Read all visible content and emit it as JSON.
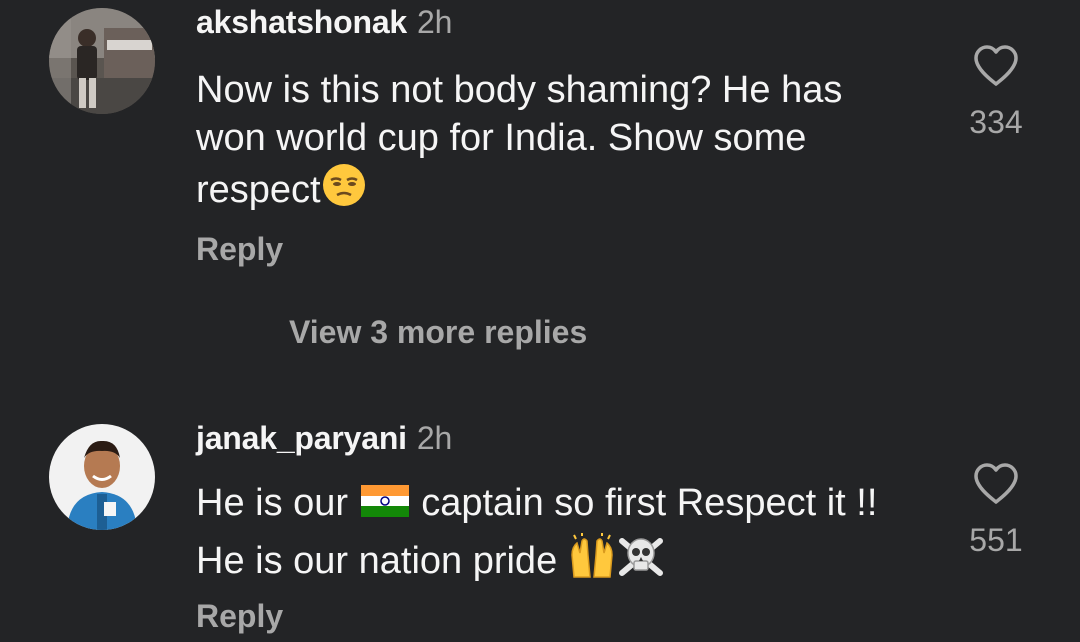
{
  "comments": [
    {
      "username": "akshatshonak",
      "time": "2h",
      "text_parts": [
        "Now is this not body shaming? He has won world cup for India. Show some respect"
      ],
      "emoji": "unamused-face",
      "reply_label": "Reply",
      "like_count": "334"
    },
    {
      "username": "janak_paryani",
      "time": "2h",
      "text_before_flag": "He is our",
      "text_after_flag": "captain so first Respect it !! He is our nation pride",
      "emojis": [
        "india-flag",
        "raised-hands",
        "skull-and-crossbones"
      ],
      "reply_label": "Reply",
      "like_count": "551"
    }
  ],
  "view_more_replies": "View 3 more replies",
  "colors": {
    "background": "#232426",
    "primary_text": "#f5f5f5",
    "secondary_text": "#a8a8a8"
  }
}
